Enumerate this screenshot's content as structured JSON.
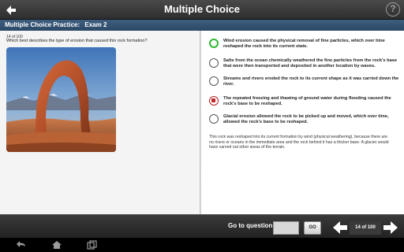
{
  "app": {
    "title": "Multiple Choice",
    "help_symbol": "?"
  },
  "exam_bar": {
    "label": "Multiple Choice Practice:",
    "exam_name": "Exam 2"
  },
  "question": {
    "counter": "14 of 100",
    "text": "Which best describes the type of erosion that caused this rock formation?"
  },
  "options": [
    {
      "text": "Wind erosion caused the physical removal of fine particles, which over time reshaped the rock into its current state.",
      "state": "correct"
    },
    {
      "text": "Salts from the ocean chemically weathered the fine particles from the rock's base that were then transported and deposited in another location by waves.",
      "state": "none"
    },
    {
      "text": "Streams and rivers eroded the rock to its current shape as it was carried down the river.",
      "state": "none"
    },
    {
      "text": "The repeated freezing and thawing of ground water during flooding caused the rock's base to be reshaped.",
      "state": "wrong"
    },
    {
      "text": "Glacial erosion allowed the rock to be picked up and moved, which over time, allowed the rock's base to be reshaped.",
      "state": "none"
    }
  ],
  "explanation": "This rock was reshaped into its current formation by wind (physical weathering), because there are no rivers or oceans in the immediate area and the rock behind it has a thicker base. A glacier would have carved out other areas of the terrain.",
  "footer": {
    "goto_label": "Go to question:",
    "go_label": "GO",
    "page_indicator": "14 of 100"
  },
  "colors": {
    "correct": "#2eb82e",
    "wrong": "#c0252a",
    "exam_bar": "#345272"
  }
}
